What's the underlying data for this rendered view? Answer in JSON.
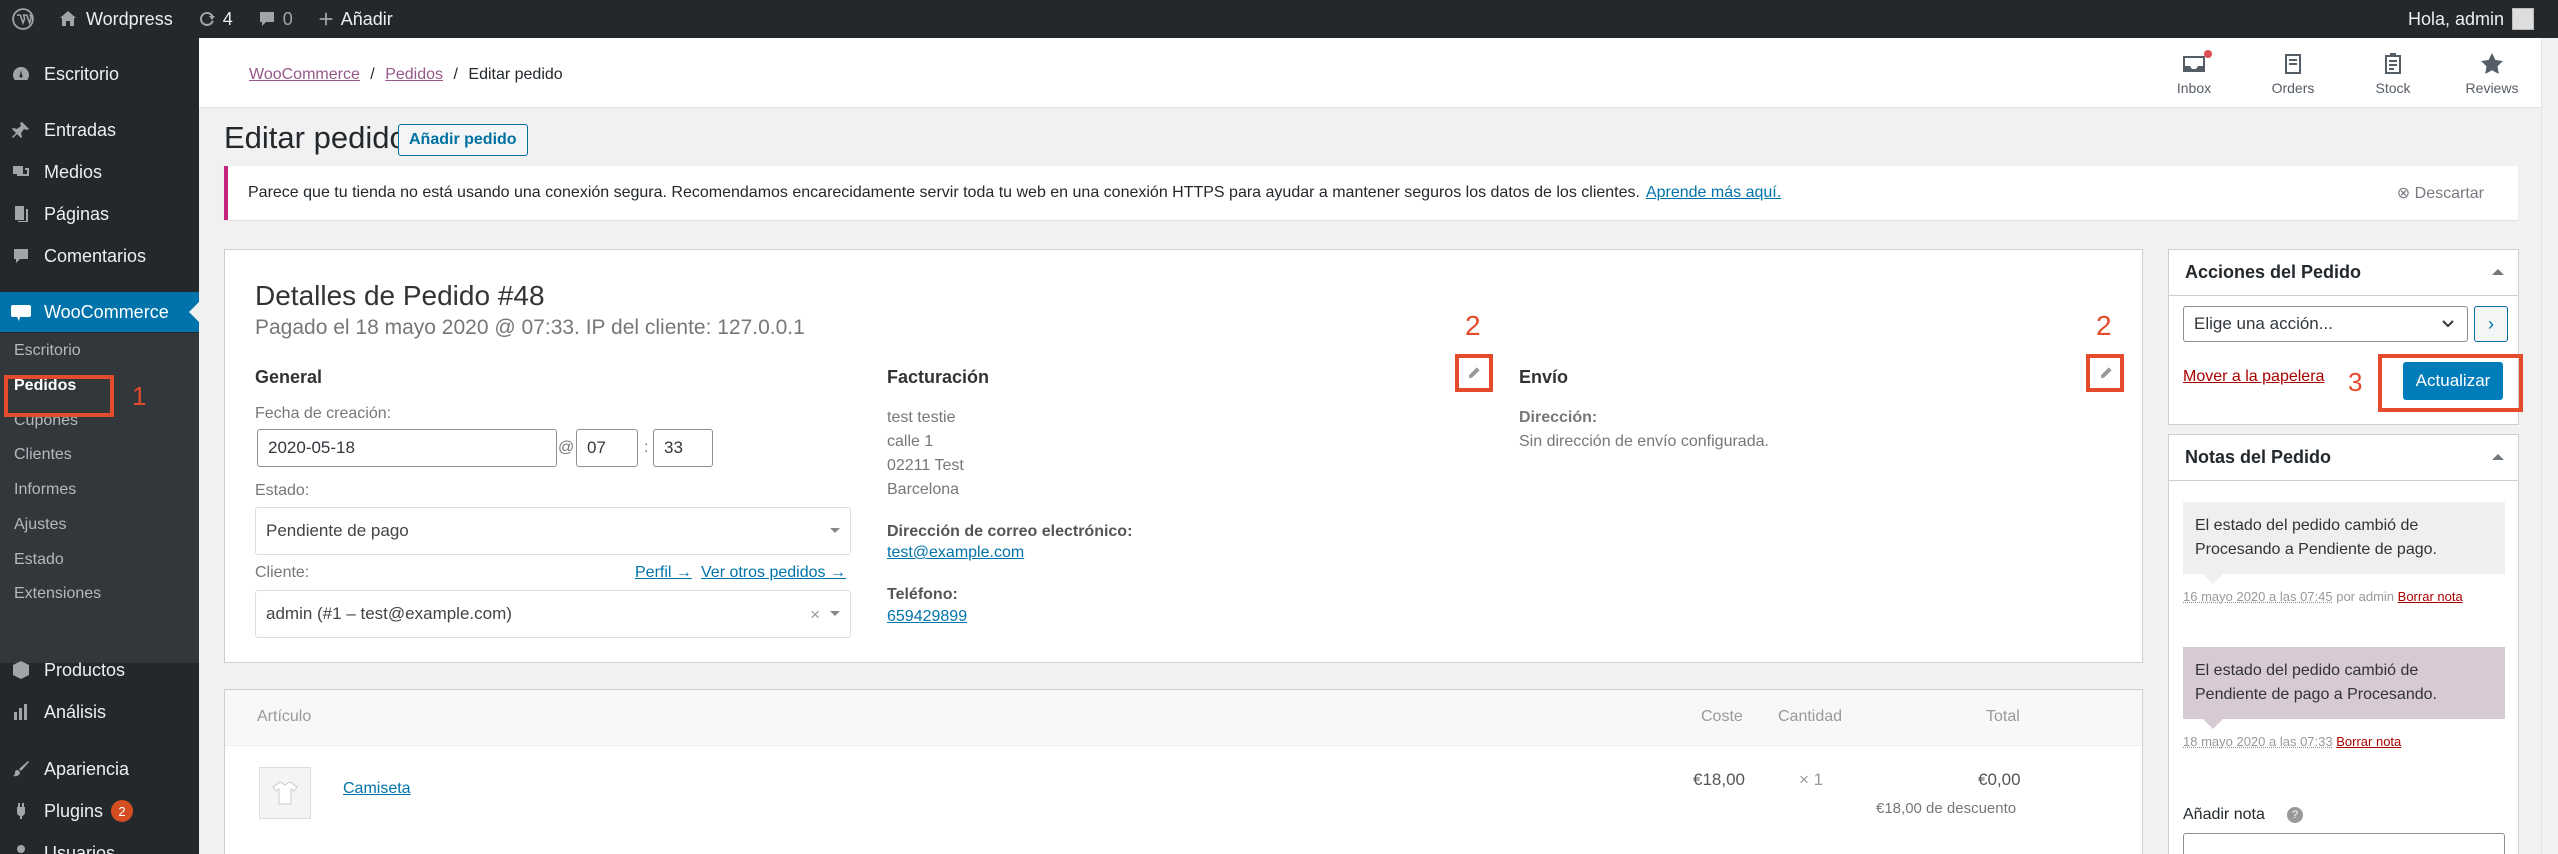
{
  "adminbar": {
    "site_name": "Wordpress",
    "updates_count": "4",
    "comments_count": "0",
    "add_new": "Añadir",
    "greeting": "Hola, admin"
  },
  "sidebar": {
    "items": [
      {
        "label": "Escritorio",
        "icon": "dashboard-icon"
      },
      {
        "label": "Entradas",
        "icon": "pin-icon"
      },
      {
        "label": "Medios",
        "icon": "media-icon"
      },
      {
        "label": "Páginas",
        "icon": "page-icon"
      },
      {
        "label": "Comentarios",
        "icon": "comment-icon"
      },
      {
        "label": "WooCommerce",
        "icon": "woo-icon"
      },
      {
        "label": "Productos",
        "icon": "box-icon"
      },
      {
        "label": "Análisis",
        "icon": "chart-icon"
      },
      {
        "label": "Apariencia",
        "icon": "brush-icon"
      },
      {
        "label": "Plugins",
        "icon": "plug-icon",
        "badge": "2"
      },
      {
        "label": "Usuarios",
        "icon": "user-icon"
      }
    ],
    "woo_submenu": [
      "Escritorio",
      "Pedidos",
      "Cupones",
      "Clientes",
      "Informes",
      "Ajustes",
      "Estado",
      "Extensiones"
    ]
  },
  "header": {
    "breadcrumb": [
      "WooCommerce",
      "Pedidos",
      "Editar pedido"
    ],
    "breadcrumb_sep": "/",
    "nav": [
      {
        "label": "Inbox",
        "icon": "inbox-icon"
      },
      {
        "label": "Orders",
        "icon": "orders-icon"
      },
      {
        "label": "Stock",
        "icon": "stock-icon"
      },
      {
        "label": "Reviews",
        "icon": "star-icon"
      }
    ]
  },
  "page": {
    "title": "Editar pedido",
    "add_order": "Añadir pedido"
  },
  "notice": {
    "text": "Parece que tu tienda no está usando una conexión segura. Recomendamos encarecidamente servir toda tu web en una conexión HTTPS para ayudar a mantener seguros los datos de los clientes.",
    "link": "Aprende más aquí.",
    "dismiss": "Descartar"
  },
  "order": {
    "title": "Detalles de Pedido #48",
    "subtitle": "Pagado el 18 mayo 2020 @ 07:33. IP del cliente: 127.0.0.1",
    "general": {
      "heading": "General",
      "date_label": "Fecha de creación:",
      "date": "2020-05-18",
      "at": "@",
      "hour": "07",
      "colon": ":",
      "minute": "33",
      "status_label": "Estado:",
      "status": "Pendiente de pago",
      "customer_label": "Cliente:",
      "profile_link": "Perfil →",
      "other_orders_link": "Ver otros pedidos →",
      "customer": "admin (#1 – test@example.com)",
      "clear": "×"
    },
    "billing": {
      "heading": "Facturación",
      "address": [
        "test testie",
        "calle 1",
        "02211 Test",
        "Barcelona"
      ],
      "email_label": "Dirección de correo electrónico:",
      "email": "test@example.com",
      "phone_label": "Teléfono:",
      "phone": "659429899"
    },
    "shipping": {
      "heading": "Envío",
      "address_label": "Dirección:",
      "address": "Sin dirección de envío configurada."
    }
  },
  "items": {
    "headers": [
      "Artículo",
      "Coste",
      "Cantidad",
      "Total"
    ],
    "rows": [
      {
        "name": "Camiseta",
        "cost": "€18,00",
        "qty": "× 1",
        "total": "€0,00",
        "discount": "€18,00 de descuento"
      }
    ]
  },
  "actions": {
    "heading": "Acciones del Pedido",
    "select": "Elige una acción...",
    "go": "›",
    "trash": "Mover a la papelera",
    "update": "Actualizar"
  },
  "notes": {
    "heading": "Notas del Pedido",
    "list": [
      {
        "text": "El estado del pedido cambió de Procesando a Pendiente de pago.",
        "date": "16 mayo 2020 a las 07:45",
        "by": " por admin ",
        "delete": "Borrar nota",
        "color": "#efefef"
      },
      {
        "text": "El estado del pedido cambió de Pendiente de pago a Procesando.",
        "date": "18 mayo 2020 a las 07:33",
        "by": " ",
        "delete": "Borrar nota",
        "color": "#d7cad2"
      }
    ],
    "add_label": "Añadir nota",
    "help": "?"
  },
  "annotations": {
    "n1": "1",
    "n2a": "2",
    "n2b": "2",
    "n3": "3",
    "color": "#e34b2a"
  },
  "colors": {
    "admin_bg": "#23282d",
    "accent": "#0073aa",
    "woo_purple": "#96588a",
    "button": "#007cba"
  }
}
